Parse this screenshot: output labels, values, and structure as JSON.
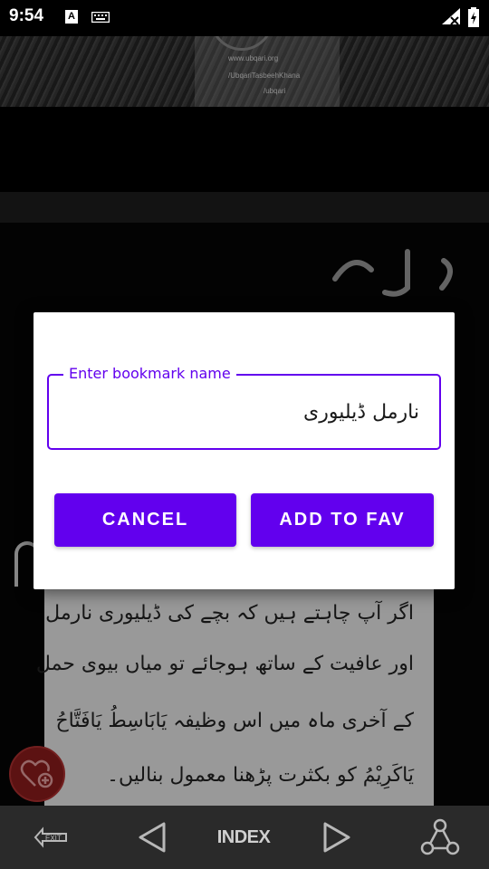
{
  "status_bar": {
    "time": "9:54",
    "a_icon_letter": "A"
  },
  "banner": {
    "line1": "www.ubqari.org",
    "line2": "/UbqariTasbeehKhana",
    "line3": "/ubqari"
  },
  "page_text": {
    "lines": [
      "اگر آپ چاہتے ہیں کہ بچے کی ڈیلیوری نارمل",
      "اور عافیت کے ساتھ ہوجائے تو میاں بیوی حمل",
      "کے آخری ماہ میں اس وظیفہ یَابَاسِطُ یَافَتَّاحُ",
      "یَاکَرِیْمُ کو بکثرت پڑھنا معمول بنالیں۔"
    ]
  },
  "dialog": {
    "field_label": "Enter bookmark name",
    "field_value": "نارمل ڈیلیوری",
    "cancel_label": "CANCEL",
    "add_label": "ADD TO FAV"
  },
  "bottom_nav": {
    "exit_label": "EXIT",
    "index_label": "INDEX"
  },
  "colors": {
    "accent": "#6200ee",
    "fav_button": "#8e1d1d",
    "nav_bar": "#2a2a2a"
  }
}
